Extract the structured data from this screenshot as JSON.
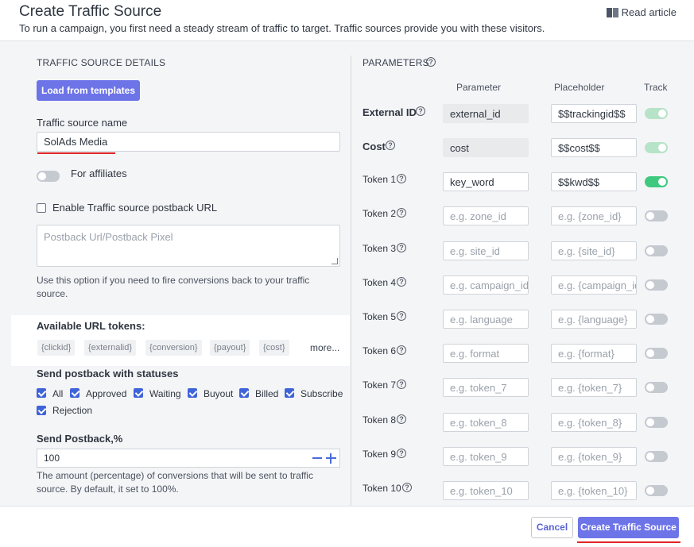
{
  "header": {
    "title": "Create Traffic Source",
    "subtitle": "To run a campaign, you first need a steady stream of traffic to target. Traffic sources provide you with these visitors.",
    "read_article": "Read article"
  },
  "details": {
    "section_title": "TRAFFIC SOURCE DETAILS",
    "load_templates": "Load from templates",
    "name_label": "Traffic source name",
    "name_value": "SolAds Media",
    "affiliates_label": "For affiliates",
    "postback_enable_label": "Enable Traffic source postback URL",
    "postback_placeholder": "Postback Url/Postback Pixel",
    "postback_help": "Use this option if you need to fire conversions back to your traffic source.",
    "tokens_label": "Available URL tokens:",
    "tokens": [
      "{clickid}",
      "{externalid}",
      "{conversion}",
      "{payout}",
      "{cost}"
    ],
    "more": "more...",
    "statuses_label": "Send postback with statuses",
    "statuses": [
      "All",
      "Approved",
      "Waiting",
      "Buyout",
      "Billed",
      "Subscribe",
      "Rejection"
    ],
    "percent_label": "Send Postback,%",
    "percent_value": "100",
    "percent_help": "The amount (percentage) of conversions that will be sent to traffic source. By default, it set to 100%."
  },
  "parameters": {
    "section_title": "PARAMETERS",
    "col_parameter": "Parameter",
    "col_placeholder": "Placeholder",
    "col_track": "Track",
    "rows": [
      {
        "label": "External ID",
        "parameter": "external_id",
        "placeholder": "$$trackingid$$",
        "track": "locked"
      },
      {
        "label": "Cost",
        "parameter": "cost",
        "placeholder": "$$cost$$",
        "track": "locked"
      },
      {
        "label": "Token 1",
        "parameter": "key_word",
        "placeholder": "$$kwd$$",
        "track": "on"
      },
      {
        "label": "Token 2",
        "parameter_ph": "e.g. zone_id",
        "placeholder_ph": "e.g. {zone_id}",
        "track": "off"
      },
      {
        "label": "Token 3",
        "parameter_ph": "e.g. site_id",
        "placeholder_ph": "e.g. {site_id}",
        "track": "off"
      },
      {
        "label": "Token 4",
        "parameter_ph": "e.g. campaign_id",
        "placeholder_ph": "e.g. {campaign_id}",
        "track": "off"
      },
      {
        "label": "Token 5",
        "parameter_ph": "e.g. language",
        "placeholder_ph": "e.g. {language}",
        "track": "off"
      },
      {
        "label": "Token 6",
        "parameter_ph": "e.g. format",
        "placeholder_ph": "e.g. {format}",
        "track": "off"
      },
      {
        "label": "Token 7",
        "parameter_ph": "e.g. token_7",
        "placeholder_ph": "e.g. {token_7}",
        "track": "off"
      },
      {
        "label": "Token 8",
        "parameter_ph": "e.g. token_8",
        "placeholder_ph": "e.g. {token_8}",
        "track": "off"
      },
      {
        "label": "Token 9",
        "parameter_ph": "e.g. token_9",
        "placeholder_ph": "e.g. {token_9}",
        "track": "off"
      },
      {
        "label": "Token 10",
        "parameter_ph": "e.g. token_10",
        "placeholder_ph": "e.g. {token_10}",
        "track": "off"
      }
    ]
  },
  "footer": {
    "cancel": "Cancel",
    "create": "Create Traffic Source"
  },
  "colors": {
    "primary": "#6d74e8",
    "toggle_on": "#3ec97f",
    "checkbox": "#3f63d9",
    "annotation": "#e0262a"
  }
}
